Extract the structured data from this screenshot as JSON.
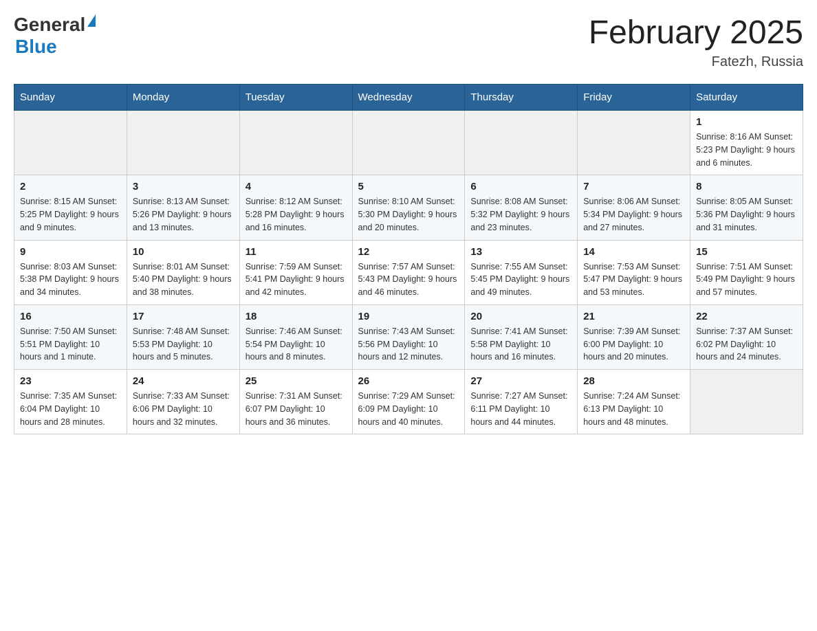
{
  "header": {
    "logo_general": "General",
    "logo_blue": "Blue",
    "month_title": "February 2025",
    "location": "Fatezh, Russia"
  },
  "weekdays": [
    "Sunday",
    "Monday",
    "Tuesday",
    "Wednesday",
    "Thursday",
    "Friday",
    "Saturday"
  ],
  "weeks": [
    [
      {
        "day": "",
        "info": ""
      },
      {
        "day": "",
        "info": ""
      },
      {
        "day": "",
        "info": ""
      },
      {
        "day": "",
        "info": ""
      },
      {
        "day": "",
        "info": ""
      },
      {
        "day": "",
        "info": ""
      },
      {
        "day": "1",
        "info": "Sunrise: 8:16 AM\nSunset: 5:23 PM\nDaylight: 9 hours and 6 minutes."
      }
    ],
    [
      {
        "day": "2",
        "info": "Sunrise: 8:15 AM\nSunset: 5:25 PM\nDaylight: 9 hours and 9 minutes."
      },
      {
        "day": "3",
        "info": "Sunrise: 8:13 AM\nSunset: 5:26 PM\nDaylight: 9 hours and 13 minutes."
      },
      {
        "day": "4",
        "info": "Sunrise: 8:12 AM\nSunset: 5:28 PM\nDaylight: 9 hours and 16 minutes."
      },
      {
        "day": "5",
        "info": "Sunrise: 8:10 AM\nSunset: 5:30 PM\nDaylight: 9 hours and 20 minutes."
      },
      {
        "day": "6",
        "info": "Sunrise: 8:08 AM\nSunset: 5:32 PM\nDaylight: 9 hours and 23 minutes."
      },
      {
        "day": "7",
        "info": "Sunrise: 8:06 AM\nSunset: 5:34 PM\nDaylight: 9 hours and 27 minutes."
      },
      {
        "day": "8",
        "info": "Sunrise: 8:05 AM\nSunset: 5:36 PM\nDaylight: 9 hours and 31 minutes."
      }
    ],
    [
      {
        "day": "9",
        "info": "Sunrise: 8:03 AM\nSunset: 5:38 PM\nDaylight: 9 hours and 34 minutes."
      },
      {
        "day": "10",
        "info": "Sunrise: 8:01 AM\nSunset: 5:40 PM\nDaylight: 9 hours and 38 minutes."
      },
      {
        "day": "11",
        "info": "Sunrise: 7:59 AM\nSunset: 5:41 PM\nDaylight: 9 hours and 42 minutes."
      },
      {
        "day": "12",
        "info": "Sunrise: 7:57 AM\nSunset: 5:43 PM\nDaylight: 9 hours and 46 minutes."
      },
      {
        "day": "13",
        "info": "Sunrise: 7:55 AM\nSunset: 5:45 PM\nDaylight: 9 hours and 49 minutes."
      },
      {
        "day": "14",
        "info": "Sunrise: 7:53 AM\nSunset: 5:47 PM\nDaylight: 9 hours and 53 minutes."
      },
      {
        "day": "15",
        "info": "Sunrise: 7:51 AM\nSunset: 5:49 PM\nDaylight: 9 hours and 57 minutes."
      }
    ],
    [
      {
        "day": "16",
        "info": "Sunrise: 7:50 AM\nSunset: 5:51 PM\nDaylight: 10 hours and 1 minute."
      },
      {
        "day": "17",
        "info": "Sunrise: 7:48 AM\nSunset: 5:53 PM\nDaylight: 10 hours and 5 minutes."
      },
      {
        "day": "18",
        "info": "Sunrise: 7:46 AM\nSunset: 5:54 PM\nDaylight: 10 hours and 8 minutes."
      },
      {
        "day": "19",
        "info": "Sunrise: 7:43 AM\nSunset: 5:56 PM\nDaylight: 10 hours and 12 minutes."
      },
      {
        "day": "20",
        "info": "Sunrise: 7:41 AM\nSunset: 5:58 PM\nDaylight: 10 hours and 16 minutes."
      },
      {
        "day": "21",
        "info": "Sunrise: 7:39 AM\nSunset: 6:00 PM\nDaylight: 10 hours and 20 minutes."
      },
      {
        "day": "22",
        "info": "Sunrise: 7:37 AM\nSunset: 6:02 PM\nDaylight: 10 hours and 24 minutes."
      }
    ],
    [
      {
        "day": "23",
        "info": "Sunrise: 7:35 AM\nSunset: 6:04 PM\nDaylight: 10 hours and 28 minutes."
      },
      {
        "day": "24",
        "info": "Sunrise: 7:33 AM\nSunset: 6:06 PM\nDaylight: 10 hours and 32 minutes."
      },
      {
        "day": "25",
        "info": "Sunrise: 7:31 AM\nSunset: 6:07 PM\nDaylight: 10 hours and 36 minutes."
      },
      {
        "day": "26",
        "info": "Sunrise: 7:29 AM\nSunset: 6:09 PM\nDaylight: 10 hours and 40 minutes."
      },
      {
        "day": "27",
        "info": "Sunrise: 7:27 AM\nSunset: 6:11 PM\nDaylight: 10 hours and 44 minutes."
      },
      {
        "day": "28",
        "info": "Sunrise: 7:24 AM\nSunset: 6:13 PM\nDaylight: 10 hours and 48 minutes."
      },
      {
        "day": "",
        "info": ""
      }
    ]
  ]
}
